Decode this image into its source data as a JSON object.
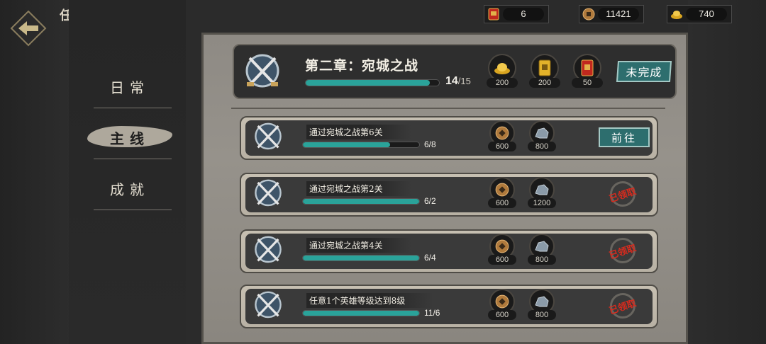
{
  "header": {
    "title": "任务"
  },
  "resources": [
    {
      "icon": "red-ticket-icon",
      "value": "6"
    },
    {
      "icon": "copper-coin-icon",
      "value": "11421"
    },
    {
      "icon": "gold-ingot-icon",
      "value": "740"
    }
  ],
  "nav": {
    "items": [
      {
        "label": "日常",
        "active": false
      },
      {
        "label": "主线",
        "active": true
      },
      {
        "label": "成就",
        "active": false
      }
    ]
  },
  "chapter": {
    "title": "第二章：宛城之战",
    "progress_current": "14",
    "progress_total": "/15",
    "progress_fraction": 0.933,
    "rewards": [
      {
        "icon": "gold-ingot-icon",
        "amount": "200"
      },
      {
        "icon": "yellow-ticket-icon",
        "amount": "200"
      },
      {
        "icon": "red-ticket-icon",
        "amount": "50"
      }
    ],
    "status_label": "未完成"
  },
  "tasks": [
    {
      "desc": "通过宛城之战第6关",
      "progress": "6/8",
      "progress_fraction": 0.75,
      "rewards": [
        {
          "icon": "copper-coin-icon",
          "amount": "600"
        },
        {
          "icon": "iron-ore-icon",
          "amount": "800"
        }
      ],
      "action": "go",
      "action_label": "前往"
    },
    {
      "desc": "通过宛城之战第2关",
      "progress": "6/2",
      "progress_fraction": 1.0,
      "rewards": [
        {
          "icon": "copper-coin-icon",
          "amount": "600"
        },
        {
          "icon": "iron-ore-icon",
          "amount": "1200"
        }
      ],
      "action": "claimed",
      "action_label": "已领取"
    },
    {
      "desc": "通过宛城之战第4关",
      "progress": "6/4",
      "progress_fraction": 1.0,
      "rewards": [
        {
          "icon": "copper-coin-icon",
          "amount": "600"
        },
        {
          "icon": "iron-ore-icon",
          "amount": "800"
        }
      ],
      "action": "claimed",
      "action_label": "已领取"
    },
    {
      "desc": "任意1个英雄等级达到8级",
      "progress": "11/6",
      "progress_fraction": 1.0,
      "rewards": [
        {
          "icon": "copper-coin-icon",
          "amount": "600"
        },
        {
          "icon": "iron-ore-icon",
          "amount": "800"
        }
      ],
      "action": "claimed",
      "action_label": "已领取"
    }
  ],
  "colors": {
    "accent_teal": "#2aa39a",
    "button_teal": "#2d6e6e",
    "claimed_red": "#d62b1e"
  }
}
